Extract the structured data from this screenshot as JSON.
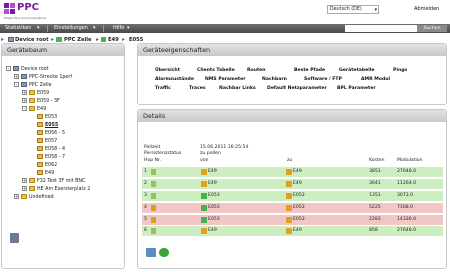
{
  "header": {
    "logo_text": "PPC",
    "logo_sub": "Power Plus Communications",
    "language": "Deutsch (DE)",
    "logout": "Abmelden"
  },
  "menu": {
    "items": [
      "Statistiken",
      "Einstellungen",
      "Hilfe"
    ],
    "search_button": "Suchen"
  },
  "breadcrumb": [
    "Device root",
    "PPC Zelle",
    "E49",
    "E055"
  ],
  "tree": {
    "title": "Gerätebaum",
    "items": [
      {
        "label": "Device root",
        "toggle": "-"
      },
      {
        "label": "PPC-Strecke 1perf",
        "toggle": "+"
      },
      {
        "label": "PPC Zelle",
        "toggle": "-"
      },
      {
        "label": "E059",
        "toggle": "+"
      },
      {
        "label": "E059 - 3F",
        "toggle": "+"
      },
      {
        "label": "E49",
        "toggle": "-"
      },
      {
        "label": "E053",
        "toggle": ""
      },
      {
        "label": "E055",
        "toggle": ""
      },
      {
        "label": "E056 - 5",
        "toggle": ""
      },
      {
        "label": "E057",
        "toggle": ""
      },
      {
        "label": "E058 - 4",
        "toggle": ""
      },
      {
        "label": "E058 - 7",
        "toggle": ""
      },
      {
        "label": "E062",
        "toggle": ""
      },
      {
        "label": "E49",
        "toggle": ""
      },
      {
        "label": "F32 Test 3F mit BNC",
        "toggle": "+"
      },
      {
        "label": "HE Am Exerzierplatz 2",
        "toggle": "+"
      },
      {
        "label": "Undefined",
        "toggle": "+"
      }
    ]
  },
  "props": {
    "title": "Geräteeigenschaften",
    "row1": [
      "Übersicht",
      "Clients Tabelle",
      "Routen",
      "Beste Pfade",
      "Gerätetabelle",
      "Pings"
    ],
    "row2": [
      "Alarmzustände",
      "NMS Parameter",
      "Nachbarn",
      "Software / FTP",
      "AMR Modul"
    ],
    "row3": [
      "Traffic",
      "Traces",
      "Nachbar Links",
      "Default Netzparameter",
      "BPL Parameter"
    ]
  },
  "details": {
    "title": "Details",
    "pollzeit_label": "Pollzeit",
    "pollzeit_value": "15.06.2011 16:25:54",
    "persistenz_label": "Persistenzstatus",
    "persistenz_value": "zu pollen",
    "columns": [
      "Hop Nr.",
      "von",
      "zu",
      "Kosten",
      "Modulation"
    ],
    "rows": [
      {
        "hop": "1",
        "von": "E49",
        "zu": "E49",
        "kosten": "3851",
        "modulation": "27648.0",
        "color": "#cdeec0"
      },
      {
        "hop": "2",
        "von": "E49",
        "zu": "E49",
        "kosten": "3041",
        "modulation": "11264.0",
        "color": "#cdeec0"
      },
      {
        "hop": "3",
        "von": "E053",
        "zu": "E053",
        "kosten": "1351",
        "modulation": "3073.0",
        "color": "#cdeec0"
      },
      {
        "hop": "4",
        "von": "E053",
        "zu": "E053",
        "kosten": "5225",
        "modulation": "7168.0",
        "color": "#f3c6c6"
      },
      {
        "hop": "5",
        "von": "E053",
        "zu": "E053",
        "kosten": "2283",
        "modulation": "14336.0",
        "color": "#f3c6c6"
      },
      {
        "hop": "6",
        "von": "E49",
        "zu": "E49",
        "kosten": "858",
        "modulation": "27648.0",
        "color": "#cdeec0"
      }
    ]
  }
}
